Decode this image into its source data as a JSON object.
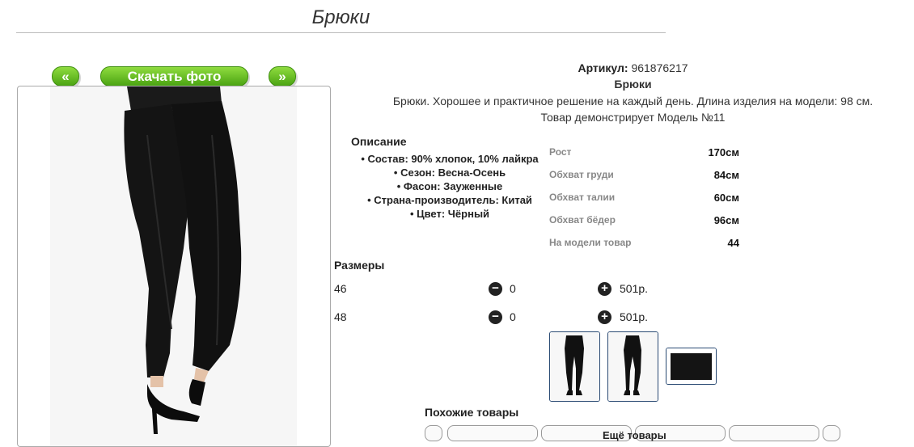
{
  "page": {
    "title": "Брюки"
  },
  "nav": {
    "prev_label": "«",
    "download_label": "Скачать фото",
    "next_label": "»"
  },
  "product": {
    "article_label": "Артикул:",
    "article_value": "961876217",
    "name": "Брюки",
    "description": "Брюки. Хорошее и практичное решение на каждый день. Длина изделия на модели: 98 см.",
    "model_note": "Товар демонстрирует Модель №11"
  },
  "description_block": {
    "title": "Описание",
    "items": [
      "Состав: 90% хлопок, 10% лайкра",
      "Сезон: Весна-Осень",
      "Фасон: Зауженные",
      "Страна-производитель: Китай",
      "Цвет: Чёрный"
    ]
  },
  "measurements": [
    {
      "label": "Рост",
      "value": "170см"
    },
    {
      "label": "Обхват груди",
      "value": "84см"
    },
    {
      "label": "Обхват талии",
      "value": "60см"
    },
    {
      "label": "Обхват бёдер",
      "value": "96см"
    },
    {
      "label": "На модели товар",
      "value": "44"
    }
  ],
  "sizes": {
    "title": "Размеры",
    "rows": [
      {
        "size": "46",
        "qty": "0",
        "price": "501р."
      },
      {
        "size": "48",
        "qty": "0",
        "price": "501р."
      }
    ],
    "minus_icon": "minus-circle-icon",
    "plus_icon": "plus-circle-icon"
  },
  "similar": {
    "title": "Похожие товары",
    "more_label": "Ещё товары"
  },
  "colors": {
    "button_green": "#5cb81f",
    "thumb_border": "#2a4a73",
    "pants": "#151515"
  }
}
